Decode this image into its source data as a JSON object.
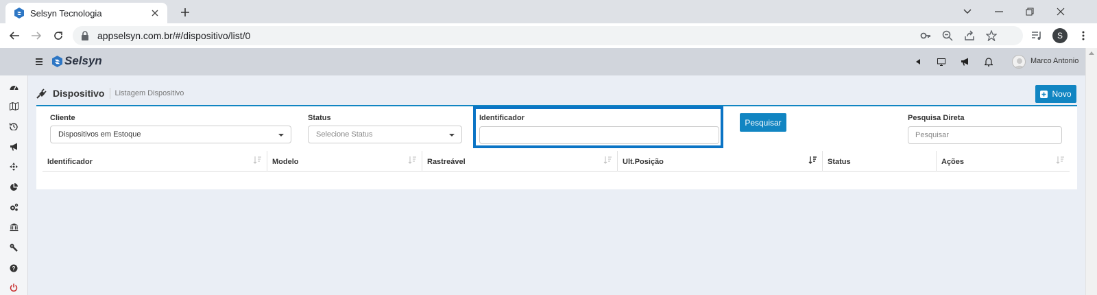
{
  "browser": {
    "tab_title": "Selsyn Tecnologia",
    "url": "appselsyn.com.br/#/dispositivo/list/0",
    "profile_initial": "S"
  },
  "app": {
    "brand": "Selsyn",
    "user_name": "Marco Antonio",
    "accent_color": "#1185c2"
  },
  "page": {
    "title": "Dispositivo",
    "subtitle": "Listagem Dispositivo",
    "new_button": "Novo"
  },
  "filters": {
    "cliente_label": "Cliente",
    "cliente_value": "Dispositivos em Estoque",
    "status_label": "Status",
    "status_placeholder": "Selecione Status",
    "identificador_label": "Identificador",
    "identificador_value": "",
    "search_button": "Pesquisar",
    "direta_label": "Pesquisa Direta",
    "direta_placeholder": "Pesquisar"
  },
  "table": {
    "columns": [
      "Identificador",
      "Modelo",
      "Rastreável",
      "Ult.Posição",
      "Status",
      "Ações"
    ]
  },
  "sidebar": {
    "icons": [
      "dashboard-icon",
      "map-icon",
      "history-icon",
      "megaphone-icon",
      "crosshair-icon",
      "pie-chart-icon",
      "cogs-icon",
      "bank-icon",
      "wrench-icon",
      "help-icon",
      "power-icon"
    ]
  }
}
